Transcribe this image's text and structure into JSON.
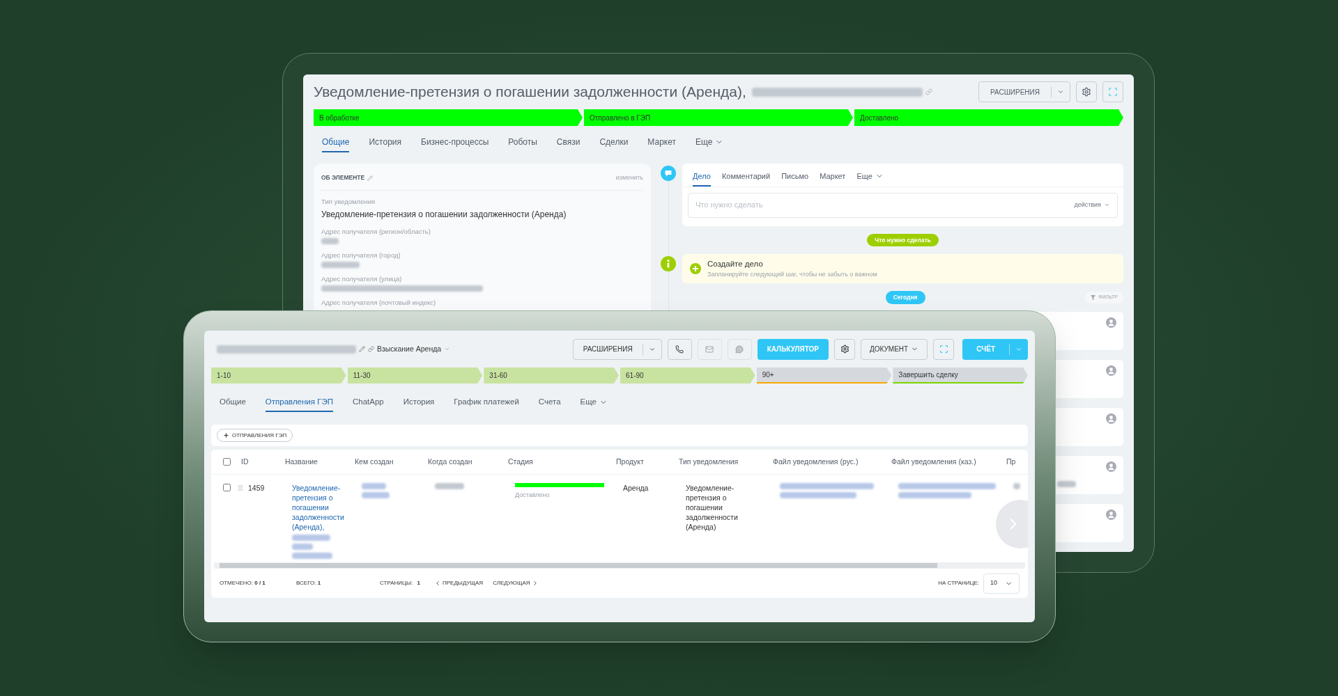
{
  "back_window": {
    "title": "Уведомление-претензия о погашении задолженности (Аренда),",
    "title_redacted": true,
    "extensions_button": "РАСШИРЕНИЯ",
    "stages": [
      {
        "label": "В обработке",
        "passed": true,
        "color": "#00ff00"
      },
      {
        "label": "Отправлено в ГЭП",
        "passed": true,
        "color": "#00ff00"
      },
      {
        "label": "Доставлено",
        "passed": true,
        "color": "#00ff00"
      }
    ],
    "tabs": [
      {
        "label": "Общие",
        "selected": true
      },
      {
        "label": "История",
        "selected": false
      },
      {
        "label": "Бизнес-процессы",
        "selected": false
      },
      {
        "label": "Роботы",
        "selected": false
      },
      {
        "label": "Связи",
        "selected": false
      },
      {
        "label": "Сделки",
        "selected": false
      },
      {
        "label": "Маркет",
        "selected": false
      },
      {
        "label": "Еще",
        "selected": false
      }
    ],
    "about": {
      "heading": "ОБ ЭЛЕМЕНТЕ",
      "edit_link": "изменить",
      "fields": [
        {
          "label": "Тип уведомления",
          "value": "Уведомление-претензия о погашении задолженности (Аренда)"
        },
        {
          "label": "Адрес получателя (регион/область)",
          "redacted": true
        },
        {
          "label": "Адрес получателя (город)",
          "redacted": true
        },
        {
          "label": "Адрес получателя (улица)",
          "redacted": true
        },
        {
          "label": "Адрес получателя (почтовый индекс)"
        }
      ]
    },
    "timeline": {
      "composer_tabs": [
        {
          "label": "Дело",
          "selected": true
        },
        {
          "label": "Комментарий",
          "selected": false
        },
        {
          "label": "Письмо",
          "selected": false
        },
        {
          "label": "Маркет",
          "selected": false
        },
        {
          "label": "Еще",
          "selected": false
        }
      ],
      "composer_placeholder": "Что нужно сделать",
      "actions": "действия",
      "todo_badge": "Что нужно сделать",
      "create_title": "Создайте дело",
      "create_hint": "Запланируйте следующий шаг, чтобы не забыть о важном",
      "today_badge": "Сегодня",
      "filter": "ФИЛЬТР",
      "entries": [
        {
          "redacted": false
        },
        {
          "redacted": false
        },
        {
          "redacted": false
        },
        {
          "redacted": true
        },
        {
          "redacted": false
        }
      ]
    }
  },
  "front_window": {
    "title_redacted": true,
    "category": "Взыскание Аренда",
    "extensions_button": "РАСШИРЕНИЯ",
    "calculator_button": "КАЛЬКУЛЯТОР",
    "document_button": "ДОКУМЕНТ",
    "invoice_button": "СЧЁТ",
    "stages": [
      {
        "label": "1-10",
        "passed": true,
        "color": "#c8e3a0"
      },
      {
        "label": "11-30",
        "passed": true,
        "color": "#c8e3a0"
      },
      {
        "label": "31-60",
        "passed": true,
        "color": "#c8e3a0"
      },
      {
        "label": "61-90",
        "passed": true,
        "color": "#c8e3a0"
      },
      {
        "label": "90+",
        "passed": false,
        "color": "#f7a700"
      },
      {
        "label": "Завершить сделку",
        "passed": false,
        "color": "#7bd500"
      }
    ],
    "tabs": [
      {
        "label": "Общие",
        "selected": false
      },
      {
        "label": "Отправления ГЭП",
        "selected": true
      },
      {
        "label": "ChatApp",
        "selected": false
      },
      {
        "label": "История",
        "selected": false
      },
      {
        "label": "График платежей",
        "selected": false
      },
      {
        "label": "Счета",
        "selected": false
      },
      {
        "label": "Еще",
        "selected": false
      }
    ],
    "add_button": "ОТПРАВЛЕНИЯ ГЭП",
    "table": {
      "all_checked": false,
      "columns": [
        "ID",
        "Название",
        "Кем создан",
        "Когда создан",
        "Стадия",
        "Продукт",
        "Тип уведомления",
        "Файл уведомления (рус.)",
        "Файл уведомления (каз.)",
        "Пр"
      ],
      "rows": [
        {
          "checked": false,
          "id": "1459",
          "title": "Уведомление-претензия о погашении задолженности (Аренда),",
          "stage": {
            "label": "Доставлено",
            "level": 1,
            "color": "#00ff00"
          },
          "product": "Аренда",
          "notification_type": "Уведомление-претензия о погашении задолженности (Аренда)"
        }
      ]
    },
    "footer": {
      "checked_label": "ОТМЕЧЕНО:",
      "checked_value": "0 / 1",
      "total_label": "ВСЕГО:",
      "total_value": "1",
      "pages_label": "СТРАНИЦЫ:",
      "pages_value": "1",
      "prev": "ПРЕДЫДУЩАЯ",
      "next": "СЛЕДУЮЩАЯ",
      "per_page_label": "НА СТРАНИЦЕ:",
      "per_page": "10"
    }
  }
}
